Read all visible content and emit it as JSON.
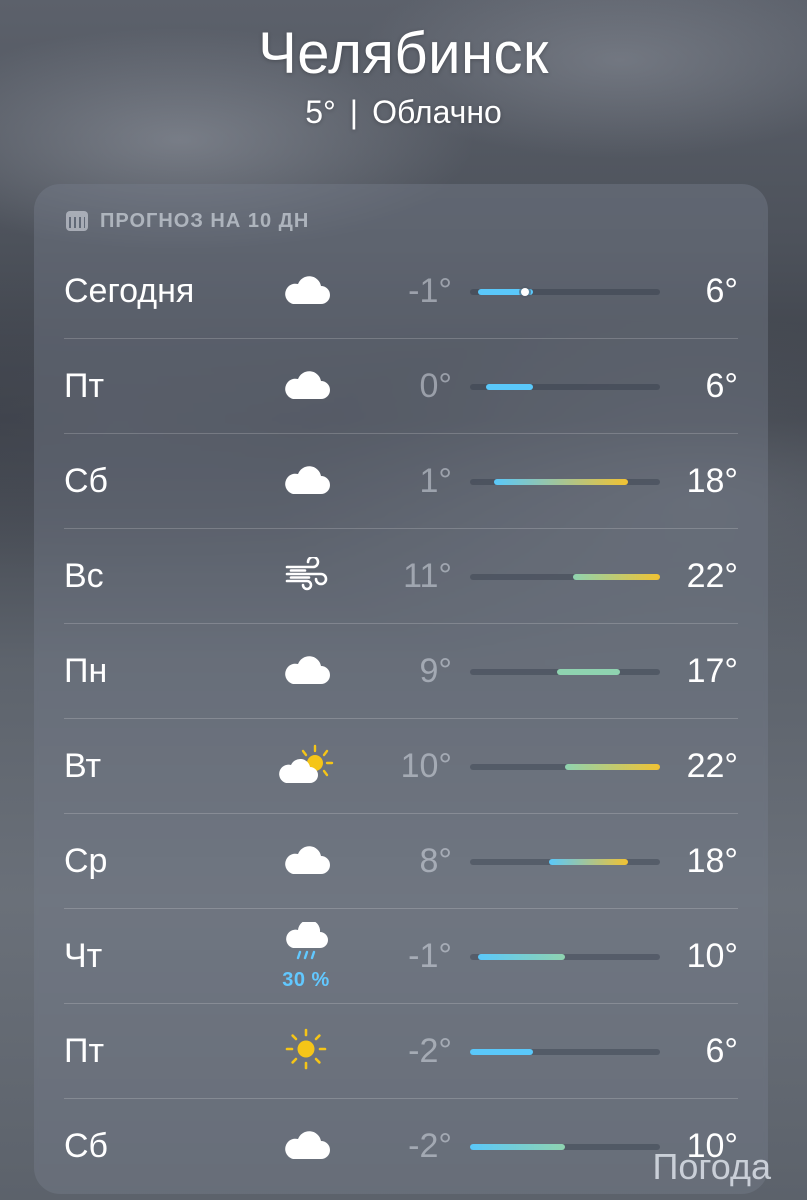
{
  "header": {
    "city": "Челябинск",
    "temp": "5°",
    "separator": "|",
    "condition": "Облачно"
  },
  "forecast": {
    "title": "ПРОГНОЗ НА 10 ДН",
    "icon": "calendar-icon",
    "colors": {
      "cold": "#5ac8fa",
      "mild": "#8fd3b0",
      "warm": "#f1c232",
      "track": "#3a4254",
      "precip": "#62c8ff"
    },
    "range_min": -2,
    "range_max": 22,
    "current_temp": 5,
    "days": [
      {
        "day": "Сегодня",
        "icon": "cloud-icon",
        "lo": "-1°",
        "hi": "6°",
        "lo_v": -1,
        "hi_v": 6,
        "precip": ""
      },
      {
        "day": "Пт",
        "icon": "cloud-icon",
        "lo": "0°",
        "hi": "6°",
        "lo_v": 0,
        "hi_v": 6,
        "precip": ""
      },
      {
        "day": "Сб",
        "icon": "cloud-icon",
        "lo": "1°",
        "hi": "18°",
        "lo_v": 1,
        "hi_v": 18,
        "precip": ""
      },
      {
        "day": "Вс",
        "icon": "wind-icon",
        "lo": "11°",
        "hi": "22°",
        "lo_v": 11,
        "hi_v": 22,
        "precip": ""
      },
      {
        "day": "Пн",
        "icon": "cloud-icon",
        "lo": "9°",
        "hi": "17°",
        "lo_v": 9,
        "hi_v": 17,
        "precip": ""
      },
      {
        "day": "Вт",
        "icon": "partly-sunny-icon",
        "lo": "10°",
        "hi": "22°",
        "lo_v": 10,
        "hi_v": 22,
        "precip": ""
      },
      {
        "day": "Ср",
        "icon": "cloud-icon",
        "lo": "8°",
        "hi": "18°",
        "lo_v": 8,
        "hi_v": 18,
        "precip": ""
      },
      {
        "day": "Чт",
        "icon": "rain-icon",
        "lo": "-1°",
        "hi": "10°",
        "lo_v": -1,
        "hi_v": 10,
        "precip": "30 %"
      },
      {
        "day": "Пт",
        "icon": "sun-icon",
        "lo": "-2°",
        "hi": "6°",
        "lo_v": -2,
        "hi_v": 6,
        "precip": ""
      },
      {
        "day": "Сб",
        "icon": "cloud-icon",
        "lo": "-2°",
        "hi": "10°",
        "lo_v": -2,
        "hi_v": 10,
        "precip": ""
      }
    ]
  },
  "brand": "Погода"
}
